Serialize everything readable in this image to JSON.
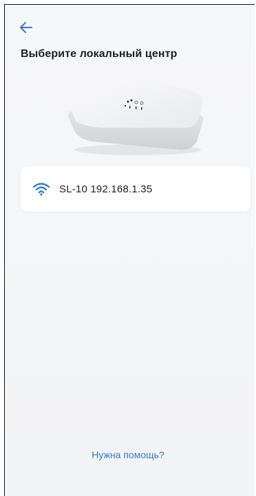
{
  "header": {
    "back_icon": "arrow-left-icon",
    "accent_color": "#2f7bd0"
  },
  "page": {
    "title": "Выберите локальный центр"
  },
  "device_list": [
    {
      "icon": "wifi-icon",
      "name": "SL-10",
      "ip": "192.168.1.35",
      "label": "SL-10  192.168.1.35"
    }
  ],
  "footer": {
    "help_link": "Нужна помощь?"
  }
}
